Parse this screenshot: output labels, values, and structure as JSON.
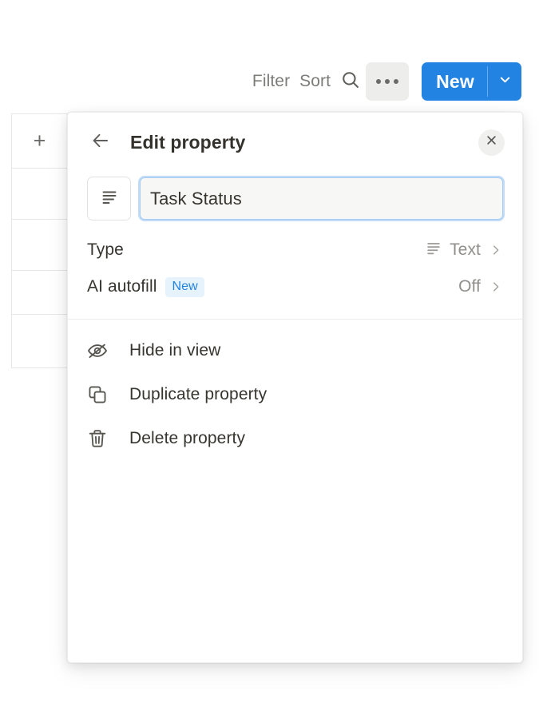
{
  "toolbar": {
    "filter_label": "Filter",
    "sort_label": "Sort",
    "search_icon": "search-icon",
    "more_icon": "ellipsis-icon",
    "new_label": "New",
    "new_caret_icon": "chevron-down-icon",
    "accent_color": "#2383E2"
  },
  "grid": {
    "add_column_label": "+",
    "rows": [
      "",
      "",
      "",
      ""
    ]
  },
  "panel": {
    "back_icon": "arrow-left-icon",
    "title": "Edit property",
    "close_icon": "close-icon",
    "name_field": {
      "type_icon": "text-lines-icon",
      "value": "Task Status",
      "placeholder": "Property name"
    },
    "properties": [
      {
        "label": "Type",
        "value": "Text",
        "value_icon": "text-lines-icon",
        "chevron_icon": "chevron-right-icon",
        "badge": null
      },
      {
        "label": "AI autofill",
        "value": "Off",
        "value_icon": null,
        "chevron_icon": "chevron-right-icon",
        "badge": "New"
      }
    ],
    "menu": [
      {
        "label": "Hide in view",
        "icon": "eye-off-icon"
      },
      {
        "label": "Duplicate property",
        "icon": "copy-icon"
      },
      {
        "label": "Delete property",
        "icon": "trash-icon"
      }
    ]
  }
}
